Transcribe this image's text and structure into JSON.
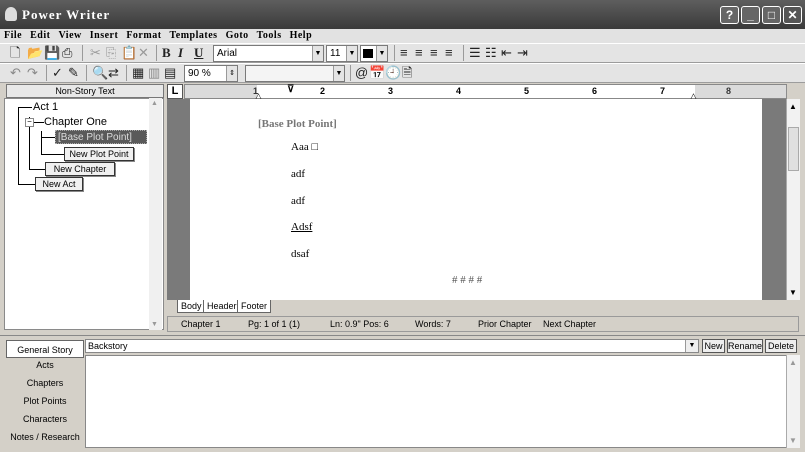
{
  "window": {
    "title": "Power Writer",
    "help_btn": "?",
    "min_btn": "_",
    "max_btn": "□",
    "close_btn": "✕"
  },
  "menu": [
    "File",
    "Edit",
    "View",
    "Insert",
    "Format",
    "Templates",
    "Goto",
    "Tools",
    "Help"
  ],
  "toolbar1": {
    "font": "Arial",
    "size": "11"
  },
  "toolbar2": {
    "zoom": "90 %"
  },
  "left": {
    "nonstory_label": "Non-Story Text",
    "tree": {
      "act": "Act 1",
      "chapter": "Chapter One",
      "plotpoint": "[Base Plot Point]",
      "new_plot_point": "New Plot Point",
      "new_chapter": "New Chapter",
      "new_act": "New Act"
    }
  },
  "ruler": {
    "marks": [
      "1",
      "2",
      "3",
      "4",
      "5",
      "6",
      "7",
      "8"
    ]
  },
  "document": {
    "header": "[Base Plot Point]",
    "lines": [
      "Aaa □",
      "adf",
      "adf",
      "Adsf",
      "dsaf"
    ],
    "end": "# # # #"
  },
  "tabs": [
    "Body",
    "Header",
    "Footer"
  ],
  "status": {
    "chapter": "Chapter 1",
    "page": "Pg: 1 of 1  (1)",
    "line": "Ln: 0.9\" Pos: 6",
    "words": "Words: 7",
    "prior": "Prior Chapter",
    "next": "Next Chapter"
  },
  "bottom": {
    "tabs": [
      "General Story",
      "Acts",
      "Chapters",
      "Plot Points",
      "Characters",
      "Notes / Research"
    ],
    "combo": "Backstory",
    "new": "New",
    "rename": "Rename",
    "delete": "Delete"
  }
}
